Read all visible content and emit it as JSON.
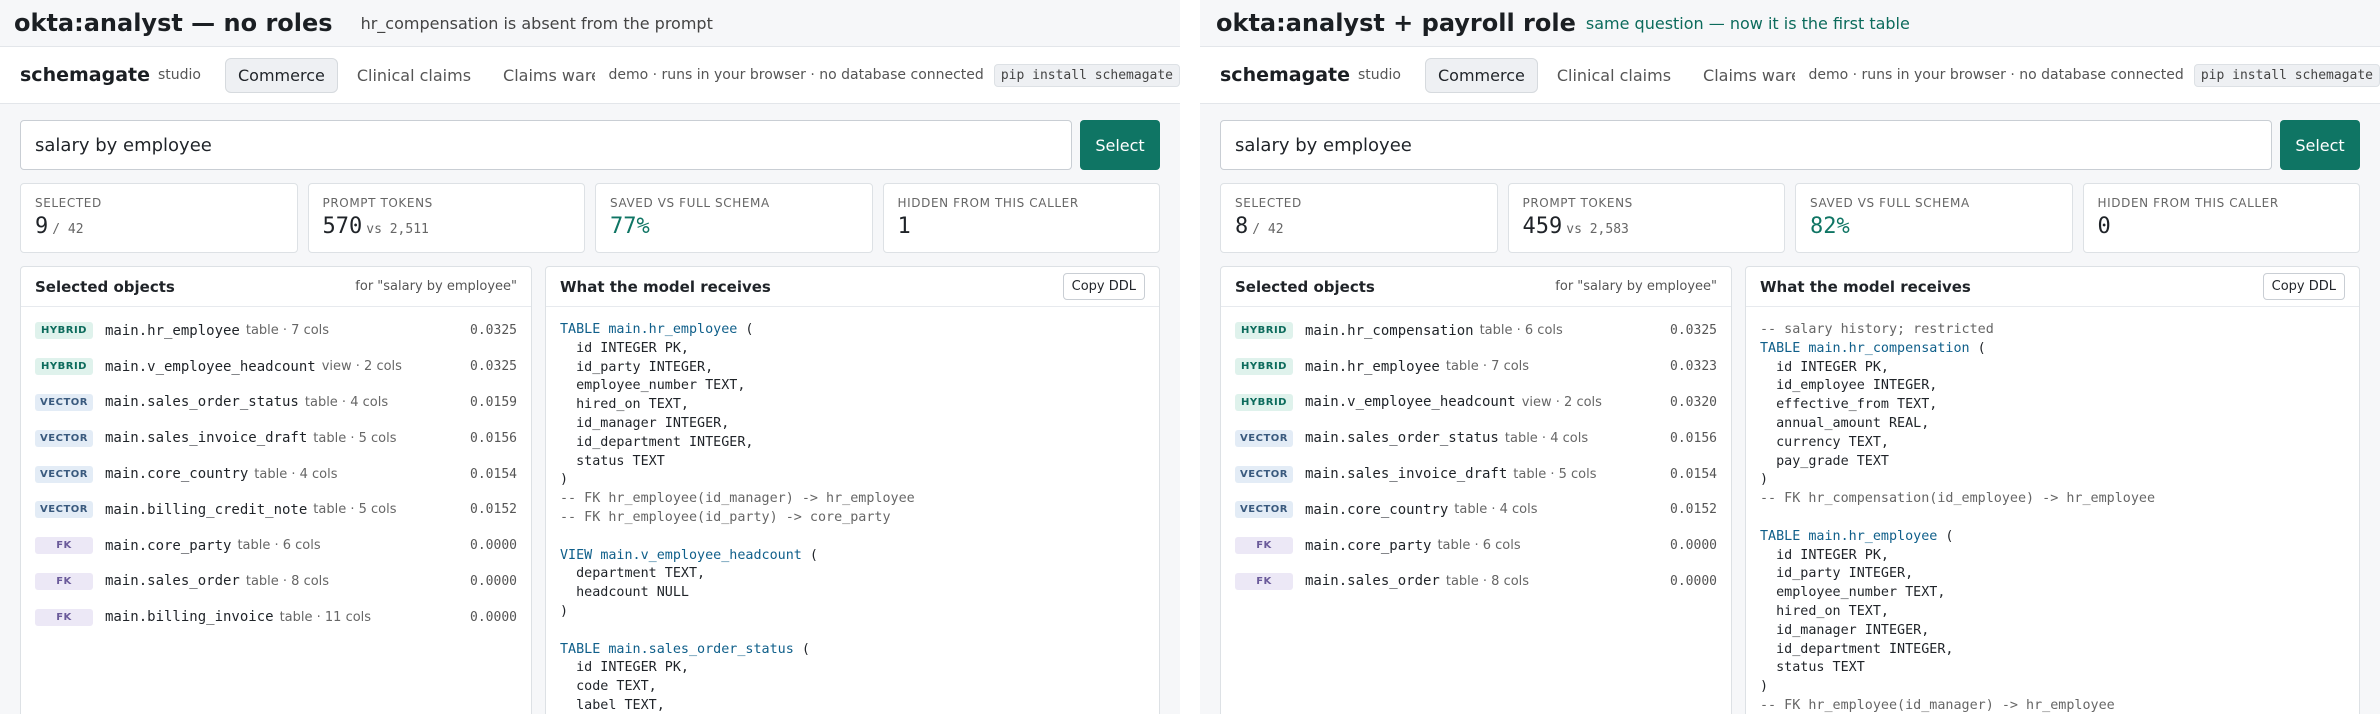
{
  "panes": [
    {
      "caption_title": "okta:analyst — no roles",
      "caption_sub": "hr_compensation is absent from the prompt",
      "brand": "schemagate",
      "brand_sub": "studio",
      "tabs": [
        "Commerce",
        "Clinical claims",
        "Claims warehouse (st"
      ],
      "demo_note": "demo · runs in your browser · no database connected",
      "pip": "pip install schemagate",
      "search_value": "salary by employee",
      "select_label": "Select",
      "stats": {
        "selected_label": "SELECTED",
        "selected": "9",
        "selected_total": "/ 42",
        "tokens_label": "PROMPT TOKENS",
        "tokens": "570",
        "tokens_vs": "vs 2,511",
        "saved_label": "SAVED VS FULL SCHEMA",
        "saved": "77%",
        "hidden_label": "HIDDEN FROM THIS CALLER",
        "hidden": "1"
      },
      "objects_title": "Selected objects",
      "objects_note": "for \"salary by employee\"",
      "objects": [
        {
          "badge": "HYBRID",
          "name": "main.hr_employee",
          "meta": "table · 7 cols",
          "score": "0.0325"
        },
        {
          "badge": "HYBRID",
          "name": "main.v_employee_headcount",
          "meta": "view · 2 cols",
          "score": "0.0325"
        },
        {
          "badge": "VECTOR",
          "name": "main.sales_order_status",
          "meta": "table · 4 cols",
          "score": "0.0159"
        },
        {
          "badge": "VECTOR",
          "name": "main.sales_invoice_draft",
          "meta": "table · 5 cols",
          "score": "0.0156"
        },
        {
          "badge": "VECTOR",
          "name": "main.core_country",
          "meta": "table · 4 cols",
          "score": "0.0154"
        },
        {
          "badge": "VECTOR",
          "name": "main.billing_credit_note",
          "meta": "table · 5 cols",
          "score": "0.0152"
        },
        {
          "badge": "FK",
          "name": "main.core_party",
          "meta": "table · 6 cols",
          "score": "0.0000"
        },
        {
          "badge": "FK",
          "name": "main.sales_order",
          "meta": "table · 8 cols",
          "score": "0.0000"
        },
        {
          "badge": "FK",
          "name": "main.billing_invoice",
          "meta": "table · 11 cols",
          "score": "0.0000"
        }
      ],
      "ddl_title": "What the model receives",
      "copy_label": "Copy DDL",
      "ddl_lines": [
        {
          "kind": "head",
          "kw": "TABLE",
          "obj": "main.hr_employee",
          "rest": " ("
        },
        {
          "kind": "text",
          "text": "  id INTEGER PK,"
        },
        {
          "kind": "text",
          "text": "  id_party INTEGER,"
        },
        {
          "kind": "text",
          "text": "  employee_number TEXT,"
        },
        {
          "kind": "text",
          "text": "  hired_on TEXT,"
        },
        {
          "kind": "text",
          "text": "  id_manager INTEGER,"
        },
        {
          "kind": "text",
          "text": "  id_department INTEGER,"
        },
        {
          "kind": "text",
          "text": "  status TEXT"
        },
        {
          "kind": "text",
          "text": ")"
        },
        {
          "kind": "comment",
          "text": "-- FK hr_employee(id_manager) -> hr_employee"
        },
        {
          "kind": "comment",
          "text": "-- FK hr_employee(id_party) -> core_party"
        },
        {
          "kind": "blank",
          "text": ""
        },
        {
          "kind": "head",
          "kw": "VIEW",
          "obj": "main.v_employee_headcount",
          "rest": " ("
        },
        {
          "kind": "text",
          "text": "  department TEXT,"
        },
        {
          "kind": "text",
          "text": "  headcount NULL"
        },
        {
          "kind": "text",
          "text": ")"
        },
        {
          "kind": "blank",
          "text": ""
        },
        {
          "kind": "head",
          "kw": "TABLE",
          "obj": "main.sales_order_status",
          "rest": " ("
        },
        {
          "kind": "text",
          "text": "  id INTEGER PK,"
        },
        {
          "kind": "text",
          "text": "  code TEXT,"
        },
        {
          "kind": "text",
          "text": "  label TEXT,"
        }
      ]
    },
    {
      "caption_title": "okta:analyst + payroll role",
      "caption_sub": "same question — now it is the first table",
      "brand": "schemagate",
      "brand_sub": "studio",
      "tabs": [
        "Commerce",
        "Clinical claims",
        "Claims warehouse (st"
      ],
      "demo_note": "demo · runs in your browser · no database connected",
      "pip": "pip install schemagate",
      "search_value": "salary by employee",
      "select_label": "Select",
      "stats": {
        "selected_label": "SELECTED",
        "selected": "8",
        "selected_total": "/ 42",
        "tokens_label": "PROMPT TOKENS",
        "tokens": "459",
        "tokens_vs": "vs 2,583",
        "saved_label": "SAVED VS FULL SCHEMA",
        "saved": "82%",
        "hidden_label": "HIDDEN FROM THIS CALLER",
        "hidden": "0"
      },
      "objects_title": "Selected objects",
      "objects_note": "for \"salary by employee\"",
      "objects": [
        {
          "badge": "HYBRID",
          "name": "main.hr_compensation",
          "meta": "table · 6 cols",
          "score": "0.0325"
        },
        {
          "badge": "HYBRID",
          "name": "main.hr_employee",
          "meta": "table · 7 cols",
          "score": "0.0323"
        },
        {
          "badge": "HYBRID",
          "name": "main.v_employee_headcount",
          "meta": "view · 2 cols",
          "score": "0.0320"
        },
        {
          "badge": "VECTOR",
          "name": "main.sales_order_status",
          "meta": "table · 4 cols",
          "score": "0.0156"
        },
        {
          "badge": "VECTOR",
          "name": "main.sales_invoice_draft",
          "meta": "table · 5 cols",
          "score": "0.0154"
        },
        {
          "badge": "VECTOR",
          "name": "main.core_country",
          "meta": "table · 4 cols",
          "score": "0.0152"
        },
        {
          "badge": "FK",
          "name": "main.core_party",
          "meta": "table · 6 cols",
          "score": "0.0000"
        },
        {
          "badge": "FK",
          "name": "main.sales_order",
          "meta": "table · 8 cols",
          "score": "0.0000"
        }
      ],
      "ddl_title": "What the model receives",
      "copy_label": "Copy DDL",
      "ddl_lines": [
        {
          "kind": "comment",
          "text": "-- salary history; restricted"
        },
        {
          "kind": "head",
          "kw": "TABLE",
          "obj": "main.hr_compensation",
          "rest": " ("
        },
        {
          "kind": "text",
          "text": "  id INTEGER PK,"
        },
        {
          "kind": "text",
          "text": "  id_employee INTEGER,"
        },
        {
          "kind": "text",
          "text": "  effective_from TEXT,"
        },
        {
          "kind": "text",
          "text": "  annual_amount REAL,"
        },
        {
          "kind": "text",
          "text": "  currency TEXT,"
        },
        {
          "kind": "text",
          "text": "  pay_grade TEXT"
        },
        {
          "kind": "text",
          "text": ")"
        },
        {
          "kind": "comment",
          "text": "-- FK hr_compensation(id_employee) -> hr_employee"
        },
        {
          "kind": "blank",
          "text": ""
        },
        {
          "kind": "head",
          "kw": "TABLE",
          "obj": "main.hr_employee",
          "rest": " ("
        },
        {
          "kind": "text",
          "text": "  id INTEGER PK,"
        },
        {
          "kind": "text",
          "text": "  id_party INTEGER,"
        },
        {
          "kind": "text",
          "text": "  employee_number TEXT,"
        },
        {
          "kind": "text",
          "text": "  hired_on TEXT,"
        },
        {
          "kind": "text",
          "text": "  id_manager INTEGER,"
        },
        {
          "kind": "text",
          "text": "  id_department INTEGER,"
        },
        {
          "kind": "text",
          "text": "  status TEXT"
        },
        {
          "kind": "text",
          "text": ")"
        },
        {
          "kind": "comment",
          "text": "-- FK hr_employee(id_manager) -> hr_employee"
        }
      ]
    }
  ]
}
